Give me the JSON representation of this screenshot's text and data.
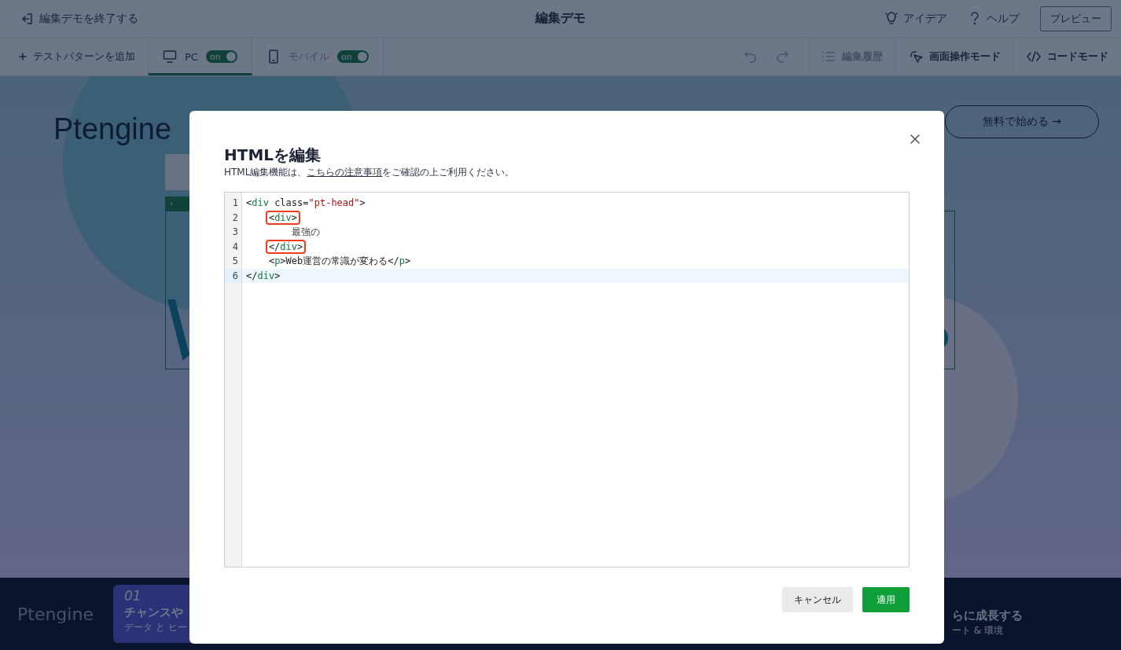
{
  "topbar": {
    "exit": {
      "label": "編集デモを終了する"
    },
    "title": "編集デモ",
    "links": [
      {
        "label": "アイデア",
        "kind": "idea"
      },
      {
        "label": "ヘルプ",
        "kind": "help"
      }
    ],
    "preview": {
      "label": "プレビュー"
    }
  },
  "toolbar": {
    "add": {
      "label": "テストパターンを追加"
    },
    "devices": [
      {
        "label": "PC",
        "kind": "desktop",
        "selected": true,
        "toggle": {
          "label": "on",
          "on": true
        }
      },
      {
        "label": "モバイル",
        "kind": "mobile",
        "selected": false,
        "toggle": {
          "label": "on",
          "on": true
        }
      }
    ],
    "undo": {
      "disabled": true
    },
    "redo": {
      "disabled": true
    },
    "actions": [
      {
        "label": "編集履歴",
        "kind": "history",
        "disabled": true
      },
      {
        "label": "画面操作モード",
        "kind": "pointer",
        "disabled": false
      },
      {
        "label": "コードモード",
        "kind": "code",
        "disabled": false
      }
    ]
  },
  "page": {
    "logo": "Ptengine",
    "cta": "無料で始める →",
    "fragment_label": "‹",
    "footer": {
      "logo": "Ptengine",
      "card": {
        "number": "01",
        "title": "チャンスや",
        "subtitle": "データ と ヒー"
      },
      "card_right": {
        "title": "らに成長する",
        "subtitle": "ート & 環境"
      }
    }
  },
  "dialog": {
    "title": "HTMLを編集",
    "note_before": "HTML編集機能は、",
    "note_link": "こちらの注意事項",
    "note_after": "をご確認の上ご利用ください。",
    "code_lines": [
      {
        "number": "1",
        "highlighted": false,
        "marked": false,
        "segments": [
          {
            "text": "<",
            "kind": "punct"
          },
          {
            "text": "div",
            "kind": "tag"
          },
          {
            "text": " class=",
            "kind": "punct"
          },
          {
            "text": "\"pt-head\"",
            "kind": "string"
          },
          {
            "text": ">",
            "kind": "punct"
          }
        ],
        "children": [
          {
            "number": "2",
            "highlighted": false,
            "marked": true,
            "segments": [
              {
                "text": "<",
                "kind": "punct"
              },
              {
                "text": "div",
                "kind": "tag"
              },
              {
                "text": ">",
                "kind": "punct"
              }
            ],
            "children": [
              {
                "number": "3",
                "highlighted": false,
                "marked": false,
                "segments": [
                  {
                    "text": "最強の",
                    "kind": "text"
                  }
                ]
              }
            ]
          },
          {
            "number": "4",
            "highlighted": false,
            "marked": true,
            "segments": [
              {
                "text": "</",
                "kind": "punct"
              },
              {
                "text": "div",
                "kind": "tag"
              },
              {
                "text": ">",
                "kind": "punct"
              }
            ]
          },
          {
            "number": "5",
            "highlighted": false,
            "marked": false,
            "segments": [
              {
                "text": "<",
                "kind": "punct"
              },
              {
                "text": "p",
                "kind": "tag"
              },
              {
                "text": ">Web運営の常識が変わる</",
                "kind": "punct"
              },
              {
                "text": "p",
                "kind": "tag"
              },
              {
                "text": ">",
                "kind": "punct"
              }
            ]
          }
        ]
      },
      {
        "number": "6",
        "highlighted": true,
        "marked": false,
        "segments": [
          {
            "text": "</",
            "kind": "punct"
          },
          {
            "text": "div",
            "kind": "tag"
          },
          {
            "text": ">",
            "kind": "punct"
          }
        ]
      }
    ],
    "buttons": [
      {
        "label": "キャンセル",
        "kind": "secondary"
      },
      {
        "label": "適用",
        "kind": "primary"
      }
    ]
  }
}
